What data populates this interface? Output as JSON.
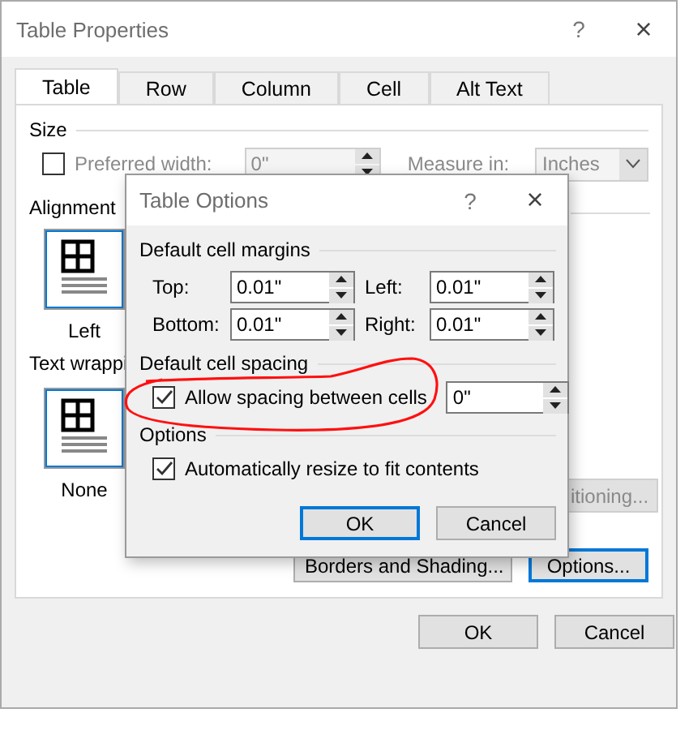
{
  "window": {
    "title": "Table Properties",
    "help": "?",
    "close": "×"
  },
  "tabs": [
    {
      "label": "Table",
      "selected": true
    },
    {
      "label": "Row",
      "selected": false
    },
    {
      "label": "Column",
      "selected": false
    },
    {
      "label": "Cell",
      "selected": false
    },
    {
      "label": "Alt Text",
      "selected": false
    }
  ],
  "size": {
    "heading": "Size",
    "preferred_width": {
      "label": "Preferred width:",
      "checked": false,
      "value": "0\"",
      "disabled": true
    },
    "measure_in": {
      "label": "Measure in:",
      "value": "Inches",
      "disabled": true
    }
  },
  "alignment": {
    "heading": "Alignment",
    "options": [
      {
        "label": "Left",
        "selected": true
      }
    ]
  },
  "text_wrapping": {
    "heading": "Text wrappi",
    "options": [
      {
        "label": "None",
        "selected": true
      }
    ],
    "positioning_button": "itioning..."
  },
  "buttons": [
    {
      "label": "Borders and Shading...",
      "focused": false
    },
    {
      "label": "Options...",
      "focused": true
    }
  ],
  "footer_buttons": [
    {
      "label": "OK",
      "focused": false
    },
    {
      "label": "Cancel",
      "focused": false
    }
  ],
  "table_options": {
    "title": "Table Options",
    "help": "?",
    "close": "×",
    "margins_heading": "Default cell margins",
    "margins": [
      {
        "label": "Top:",
        "value": "0.01\""
      },
      {
        "label": "Left:",
        "value": "0.01\""
      },
      {
        "label": "Bottom:",
        "value": "0.01\""
      },
      {
        "label": "Right:",
        "value": "0.01\""
      }
    ],
    "spacing_heading": "Default cell spacing",
    "allow_spacing": {
      "label": "Allow spacing between cells",
      "checked": true,
      "value": "0\""
    },
    "options_heading": "Options",
    "auto_resize": {
      "label": "Automatically resize to fit contents",
      "checked": true
    },
    "buttons": [
      {
        "label": "OK",
        "focused": true
      },
      {
        "label": "Cancel",
        "focused": false
      }
    ]
  }
}
